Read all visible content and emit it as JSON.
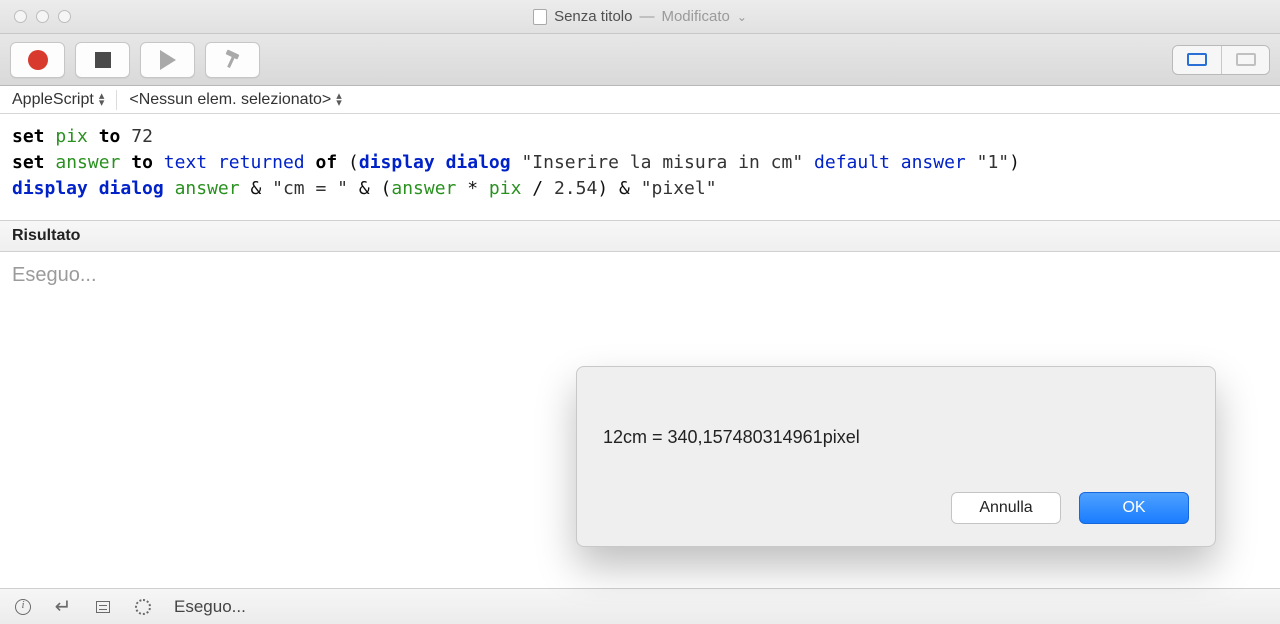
{
  "titlebar": {
    "document_name": "Senza titolo",
    "separator": "—",
    "modified_label": "Modificato"
  },
  "navbar": {
    "language": "AppleScript",
    "selection": "<Nessun elem. selezionato>"
  },
  "code": {
    "line1": {
      "kw1": "set",
      "var1": "pix",
      "kw2": "to",
      "num": "72"
    },
    "line2": {
      "kw1": "set",
      "var1": "answer",
      "kw2": "to",
      "param1": "text returned",
      "kw3": "of",
      "open": "(",
      "cmd": "display dialog",
      "str1": "\"Inserire la misura in cm\"",
      "param2": "default answer",
      "str2": "\"1\"",
      "close": ")"
    },
    "line3": {
      "cmd": "display dialog",
      "var1": "answer",
      "amp1": "&",
      "str1": "\"cm = \"",
      "amp2": "&",
      "open": "(",
      "var2": "answer",
      "op1": "*",
      "var3": "pix",
      "op2": "/",
      "num": "2.54",
      "close": ")",
      "amp3": "&",
      "str2": "\"pixel\""
    }
  },
  "results": {
    "header": "Risultato",
    "running": "Eseguo..."
  },
  "statusbar": {
    "running": "Eseguo..."
  },
  "dialog": {
    "message": "12cm = 340,157480314961pixel",
    "cancel": "Annulla",
    "ok": "OK"
  }
}
